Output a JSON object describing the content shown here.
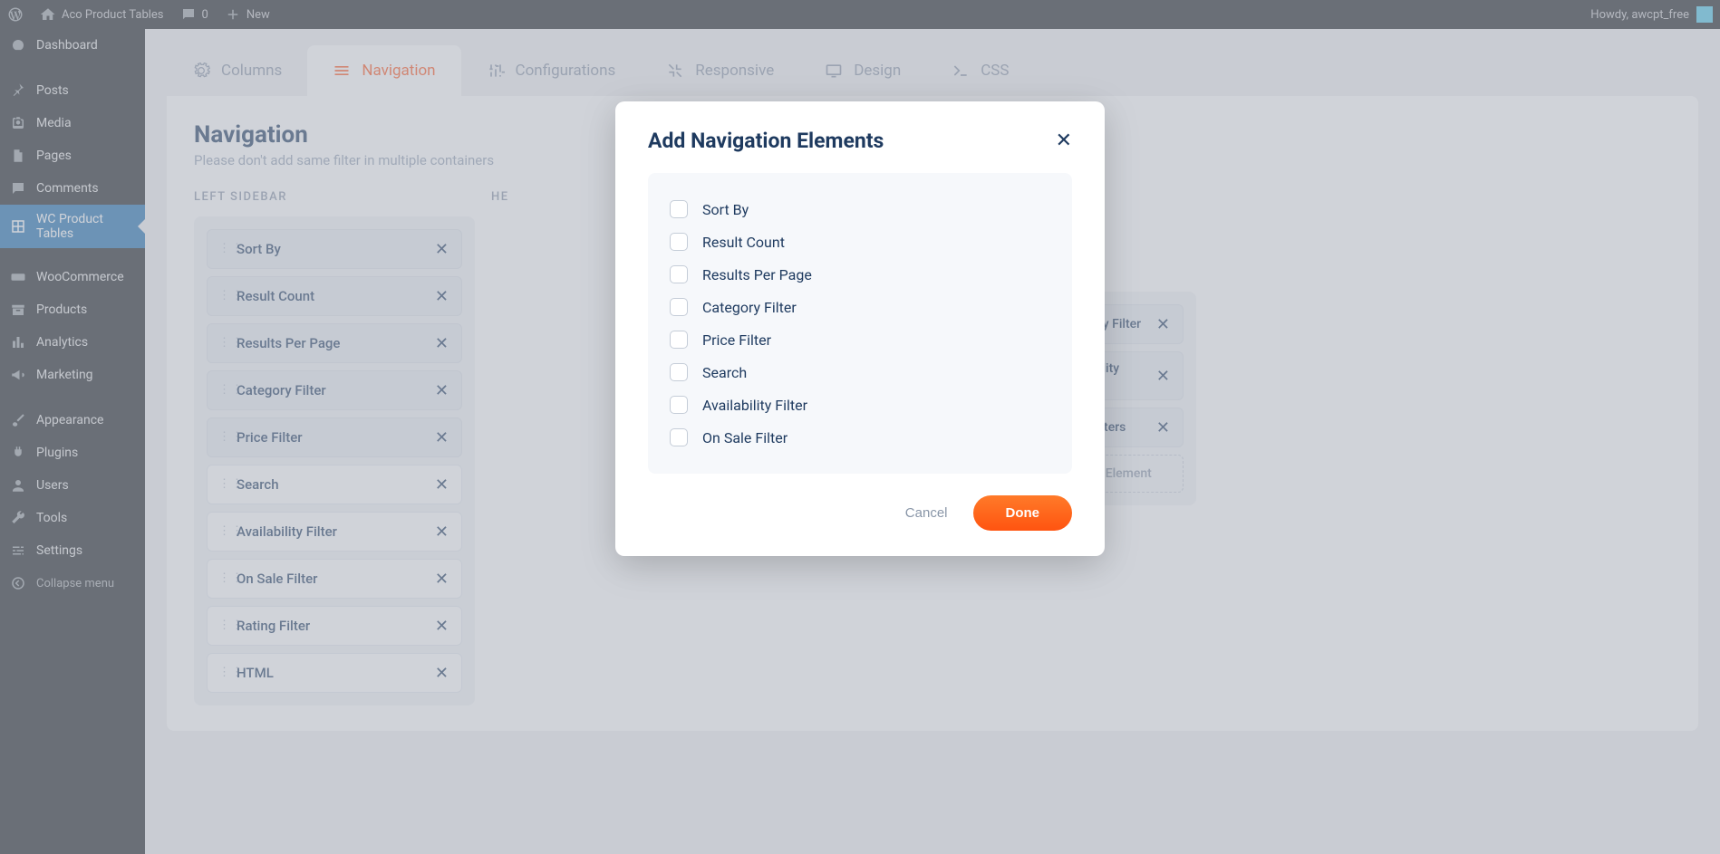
{
  "adminbar": {
    "site_name": "Aco Product Tables",
    "comments_count": "0",
    "new_label": "New",
    "howdy": "Howdy, awcpt_free"
  },
  "sidebar": {
    "items": [
      {
        "label": "Dashboard",
        "icon": "dashboard"
      },
      {
        "label": "Posts",
        "icon": "pin"
      },
      {
        "label": "Media",
        "icon": "media"
      },
      {
        "label": "Pages",
        "icon": "page"
      },
      {
        "label": "Comments",
        "icon": "comment"
      },
      {
        "label": "WC Product Tables",
        "icon": "grid",
        "active": true
      },
      {
        "label": "WooCommerce",
        "icon": "woo"
      },
      {
        "label": "Products",
        "icon": "archive"
      },
      {
        "label": "Analytics",
        "icon": "bars"
      },
      {
        "label": "Marketing",
        "icon": "megaphone"
      },
      {
        "label": "Appearance",
        "icon": "brush"
      },
      {
        "label": "Plugins",
        "icon": "plug"
      },
      {
        "label": "Users",
        "icon": "user"
      },
      {
        "label": "Tools",
        "icon": "wrench"
      },
      {
        "label": "Settings",
        "icon": "sliders"
      }
    ],
    "collapse": "Collapse menu"
  },
  "tabs": [
    {
      "label": "Columns",
      "icon": "gear"
    },
    {
      "label": "Navigation",
      "icon": "list",
      "active": true
    },
    {
      "label": "Configurations",
      "icon": "tune"
    },
    {
      "label": "Responsive",
      "icon": "compress"
    },
    {
      "label": "Design",
      "icon": "screen"
    },
    {
      "label": "CSS",
      "icon": "prompt"
    }
  ],
  "panel": {
    "title": "Navigation",
    "subtitle": "Please don't add same filter in multiple containers",
    "col_left_label": "LEFT SIDEBAR",
    "col_header_label": "HE",
    "left_items": [
      "Sort By",
      "Result Count",
      "Results Per Page",
      "Category Filter",
      "Price Filter",
      "Search",
      "Availability Filter",
      "On Sale Filter",
      "Rating Filter",
      "HTML"
    ],
    "right_items": [
      "Category Filter",
      "Availability Filter",
      "Clear Filters"
    ],
    "add_element": "Add Element"
  },
  "modal": {
    "title": "Add Navigation Elements",
    "options": [
      "Sort By",
      "Result Count",
      "Results Per Page",
      "Category Filter",
      "Price Filter",
      "Search",
      "Availability Filter",
      "On Sale Filter"
    ],
    "cancel": "Cancel",
    "done": "Done"
  }
}
